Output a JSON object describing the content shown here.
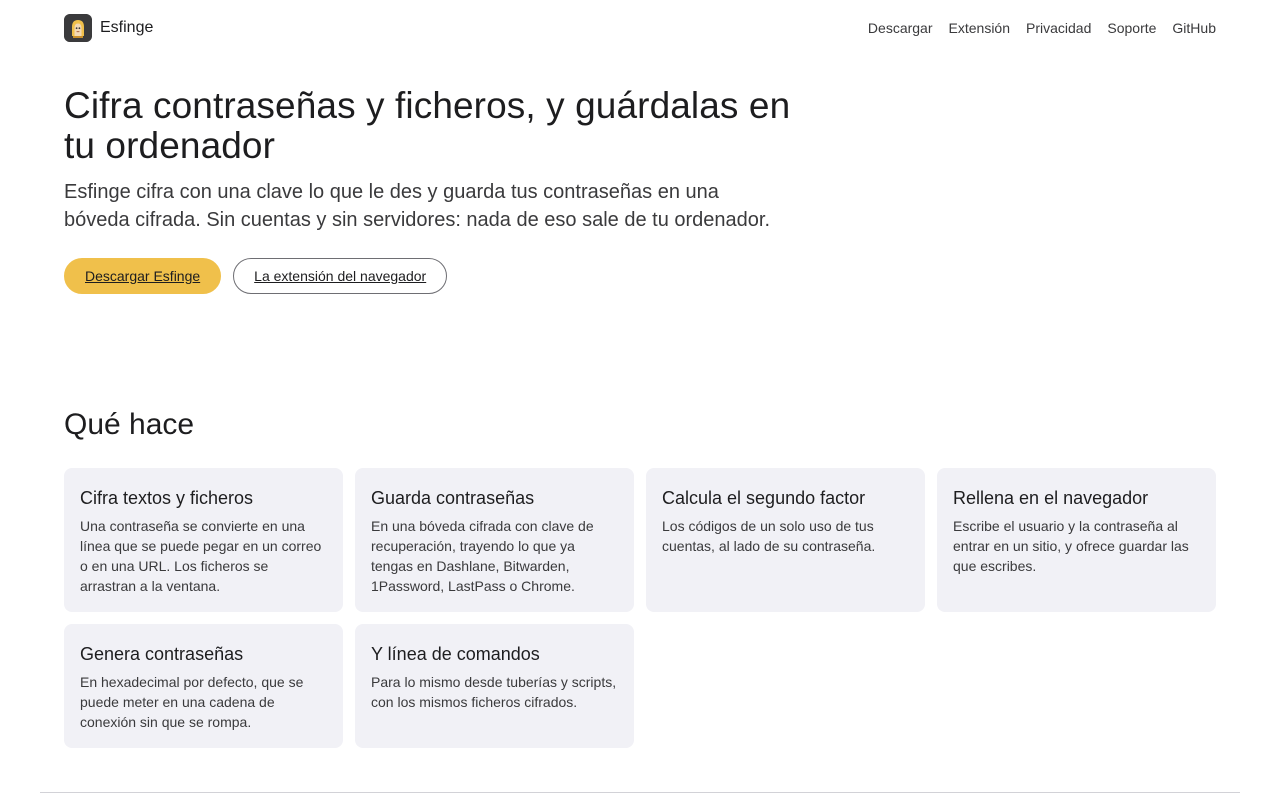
{
  "header": {
    "brand_name": "Esfinge",
    "nav": [
      "Descargar",
      "Extensión",
      "Privacidad",
      "Soporte",
      "GitHub"
    ]
  },
  "hero": {
    "title": "Cifra contraseñas y ficheros, y guárdalas en tu ordenador",
    "subtitle": "Esfinge cifra con una clave lo que le des y guarda tus contraseñas en una bóveda cifrada. Sin cuentas y sin servidores: nada de eso sale de tu ordenador.",
    "primary_button": "Descargar Esfinge",
    "secondary_button": "La extensión del navegador"
  },
  "features": {
    "title": "Qué hace",
    "cards": [
      {
        "title": "Cifra textos y ficheros",
        "text": "Una contraseña se convierte en una línea que se puede pegar en un correo o en una URL. Los ficheros se arrastran a la ventana."
      },
      {
        "title": "Guarda contraseñas",
        "text": "En una bóveda cifrada con clave de recuperación, trayendo lo que ya tengas en Dashlane, Bitwarden, 1Password, LastPass o Chrome."
      },
      {
        "title": "Calcula el segundo factor",
        "text": "Los códigos de un solo uso de tus cuentas, al lado de su contraseña."
      },
      {
        "title": "Rellena en el navegador",
        "text": "Escribe el usuario y la contraseña al entrar en un sitio, y ofrece guardar las que escribes."
      },
      {
        "title": "Genera contraseñas",
        "text": "En hexadecimal por defecto, que se puede meter en una cadena de conexión sin que se rompa."
      },
      {
        "title": "Y línea de comandos",
        "text": "Para lo mismo desde tuberías y scripts, con los mismos ficheros cifrados."
      }
    ]
  },
  "colors": {
    "accent": "#f0c04b",
    "card_background": "#f1f1f6",
    "text": "#1d1d1f"
  }
}
